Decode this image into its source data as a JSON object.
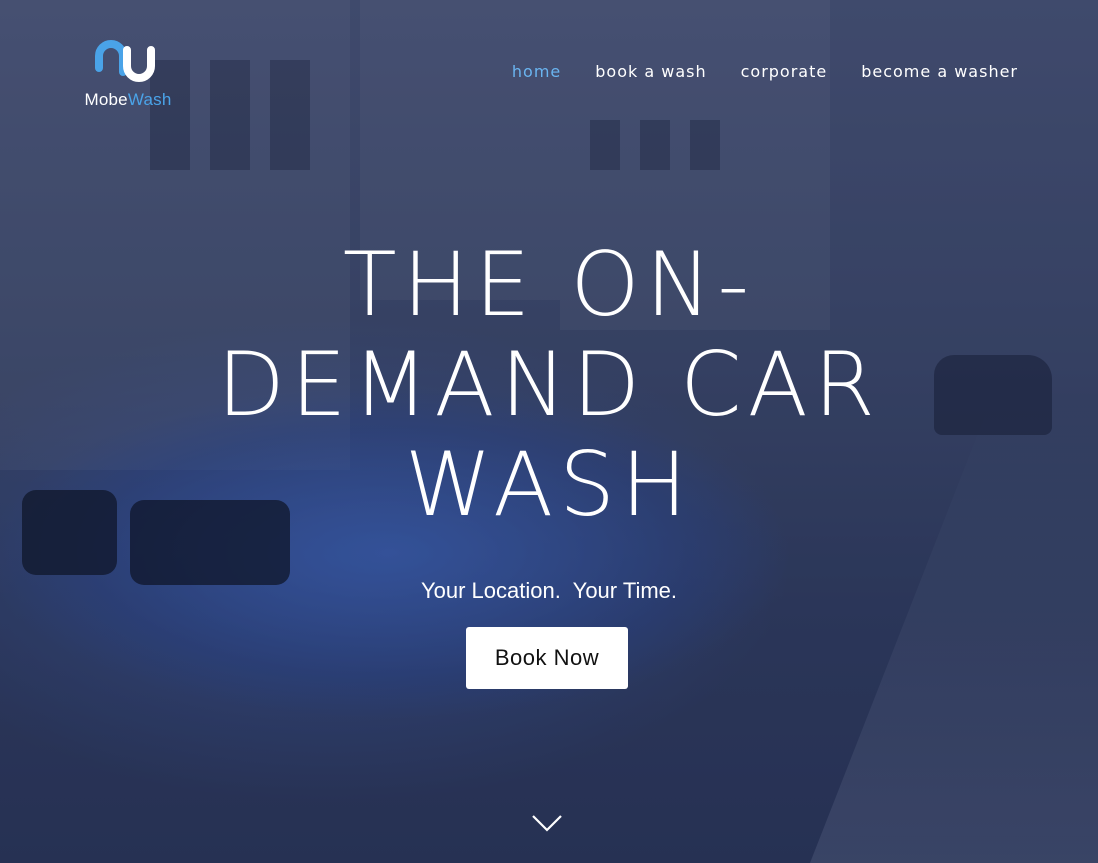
{
  "brand": {
    "name_part1": "Mobe",
    "name_part2": "Wash",
    "accent_color": "#4aa3e8"
  },
  "nav": [
    {
      "label": "home",
      "active": true
    },
    {
      "label": "book a wash",
      "active": false
    },
    {
      "label": "corporate",
      "active": false
    },
    {
      "label": "become a washer",
      "active": false
    }
  ],
  "hero": {
    "headline_line1": "THE ON-",
    "headline_line2": "DEMAND CAR",
    "headline_line3": "WASH",
    "tagline": "Your Location.  Your Time.",
    "cta_label": "Book Now",
    "scroll_icon": "chevron-down-icon"
  },
  "colors": {
    "nav_active": "#6ab4f0",
    "button_bg": "#ffffff"
  }
}
